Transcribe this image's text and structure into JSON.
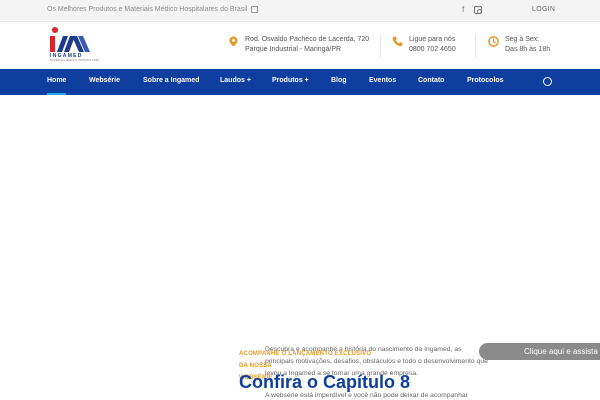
{
  "topbar": {
    "tagline": "Os Melhores Produtos e Materiais Médico Hospitalares do Brasil",
    "social_facebook": "f",
    "login_label": "LOGIN"
  },
  "header": {
    "logo_brand": "INGAMED",
    "logo_sub": "MATERIAIS MÉDICO HOSPITALARES",
    "address_line1": "Rod. Osvaldo Pacheco de Lacerda, 720",
    "address_line2": "Parque Industrial - Maringá/PR",
    "phone_label": "Ligue para nós",
    "phone_number": "0800 702 4650",
    "hours_label": "Seg à Sex:",
    "hours_value": "Das 8h às 18h"
  },
  "nav": {
    "items": [
      {
        "label": "Home"
      },
      {
        "label": "Websérie"
      },
      {
        "label": "Sobre a Ingamed"
      },
      {
        "label": "Laudos +"
      },
      {
        "label": "Produtos +"
      },
      {
        "label": "Blog"
      },
      {
        "label": "Eventos"
      },
      {
        "label": "Contato"
      },
      {
        "label": "Protocolos"
      }
    ]
  },
  "hero": {
    "eyebrow_line1": "ACOMPANHE O LANÇAMENTO EXCLUSIVO DA NOSSA",
    "eyebrow_line2": "WEBSÉRIE",
    "description": "Descubra e acompanhe a história do nascimento da Ingamed, as principais motivações, desafios, obstáculos e todo o desenvolvimento que levou a Ingamed a se tornar uma grande empresa.",
    "headline": "Confira o Capítulo 8",
    "description2": "A websérie está imperdível e você não pode deixar de acompanhar"
  },
  "chat": {
    "label": "Clique aqui e assista o"
  },
  "colors": {
    "nav_bg": "#0d3ea0",
    "accent_orange": "#e39b27",
    "brand_red": "#d9232d",
    "active_underline": "#27a9e1"
  }
}
